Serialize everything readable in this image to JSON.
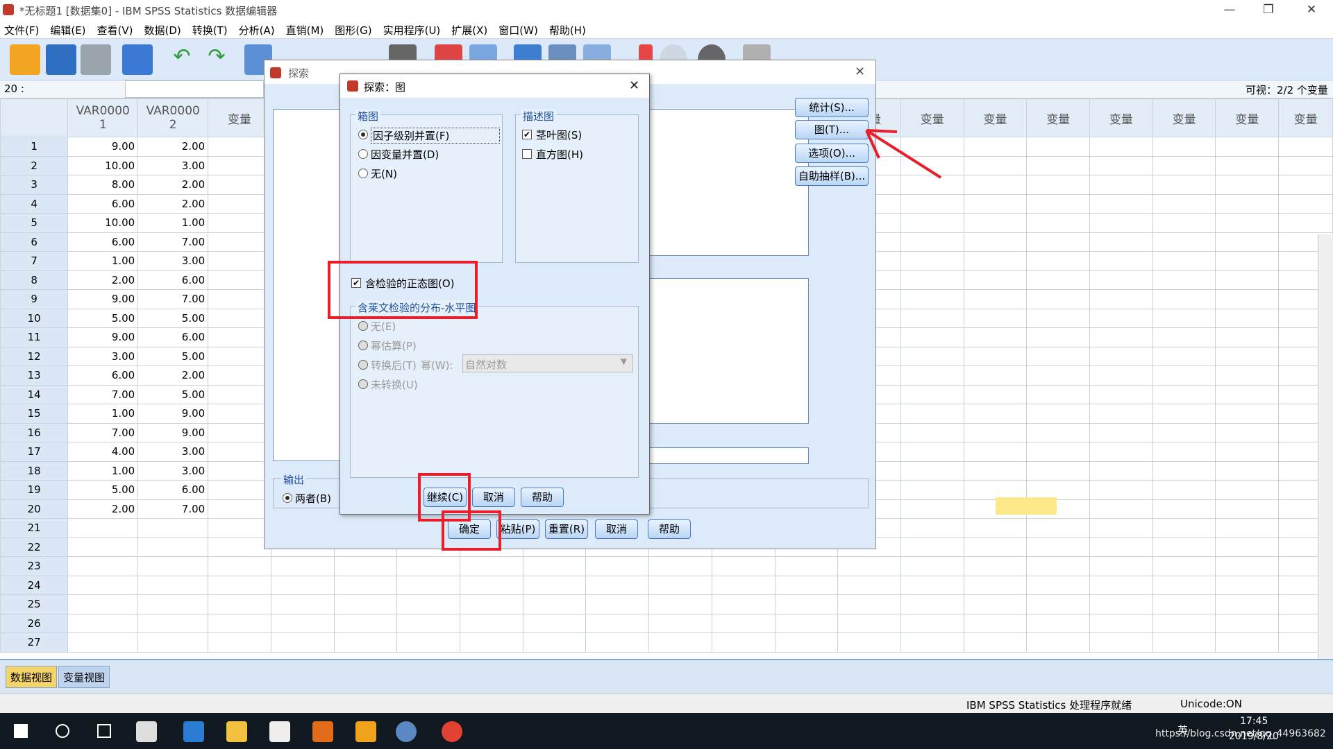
{
  "window": {
    "title": "*无标题1 [数据集0] - IBM SPSS Statistics 数据编辑器"
  },
  "menu": [
    "文件(F)",
    "编辑(E)",
    "查看(V)",
    "数据(D)",
    "转换(T)",
    "分析(A)",
    "直销(M)",
    "图形(G)",
    "实用程序(U)",
    "扩展(X)",
    "窗口(W)",
    "帮助(H)"
  ],
  "cellbar": {
    "cell": "20 :",
    "visible": "可视：2/2 个变量"
  },
  "grid": {
    "col1": [
      "VAR0000",
      "1"
    ],
    "col2": [
      "VAR0000",
      "2"
    ],
    "var_label": "变量",
    "rows": [
      [
        "1",
        "9.00",
        "2.00"
      ],
      [
        "2",
        "10.00",
        "3.00"
      ],
      [
        "3",
        "8.00",
        "2.00"
      ],
      [
        "4",
        "6.00",
        "2.00"
      ],
      [
        "5",
        "10.00",
        "1.00"
      ],
      [
        "6",
        "6.00",
        "7.00"
      ],
      [
        "7",
        "1.00",
        "3.00"
      ],
      [
        "8",
        "2.00",
        "6.00"
      ],
      [
        "9",
        "9.00",
        "7.00"
      ],
      [
        "10",
        "5.00",
        "5.00"
      ],
      [
        "11",
        "9.00",
        "6.00"
      ],
      [
        "12",
        "3.00",
        "5.00"
      ],
      [
        "13",
        "6.00",
        "2.00"
      ],
      [
        "14",
        "7.00",
        "5.00"
      ],
      [
        "15",
        "1.00",
        "9.00"
      ],
      [
        "16",
        "7.00",
        "9.00"
      ],
      [
        "17",
        "4.00",
        "3.00"
      ],
      [
        "18",
        "1.00",
        "3.00"
      ],
      [
        "19",
        "5.00",
        "6.00"
      ],
      [
        "20",
        "2.00",
        "7.00"
      ],
      [
        "21",
        "",
        ""
      ],
      [
        "22",
        "",
        ""
      ],
      [
        "23",
        "",
        ""
      ],
      [
        "24",
        "",
        ""
      ],
      [
        "25",
        "",
        ""
      ],
      [
        "26",
        "",
        ""
      ],
      [
        "27",
        "",
        ""
      ]
    ]
  },
  "tabs": {
    "data_view": "数据视图",
    "variable_view": "变量视图"
  },
  "status": {
    "processor": "IBM SPSS Statistics 处理程序就绪",
    "unicode": "Unicode:ON"
  },
  "explore": {
    "title": "探索",
    "buttons": {
      "stats": "统计(S)...",
      "plots": "图(T)...",
      "options": "选项(O)...",
      "bootstrap": "自助抽样(B)..."
    },
    "output_label": "输出",
    "output_both": "两者(B)",
    "bottom": {
      "ok": "确定",
      "paste": "粘贴(P)",
      "reset": "重置(R)",
      "cancel": "取消",
      "help": "帮助"
    }
  },
  "plots": {
    "title": "探索：图",
    "boxplot_label": "箱图",
    "box_opt1": "因子级别并置(F)",
    "box_opt2": "因变量并置(D)",
    "box_opt3": "无(N)",
    "desc_label": "描述图",
    "stemleaf": "茎叶图(S)",
    "histogram": "直方图(H)",
    "normality": "含检验的正态图(O)",
    "levene_label": "含莱文检验的分布-水平图",
    "lev_none": "无(E)",
    "lev_power": "幂估算(P)",
    "lev_trans": "转换后(T)",
    "lev_power_label": "幂(W):",
    "lev_select": "自然对数",
    "lev_untrans": "未转换(U)",
    "continue": "继续(C)",
    "cancel": "取消",
    "help": "帮助"
  },
  "taskbar": {
    "time": "17:45",
    "date": "2019/8/20",
    "ime": "英",
    "watermark": "https://blog.csdn.net/qq_44963682"
  },
  "colors": {
    "accent": "#2d77d9",
    "highlight_cell": "#fde98a",
    "annotation_red": "#e81f2b"
  }
}
